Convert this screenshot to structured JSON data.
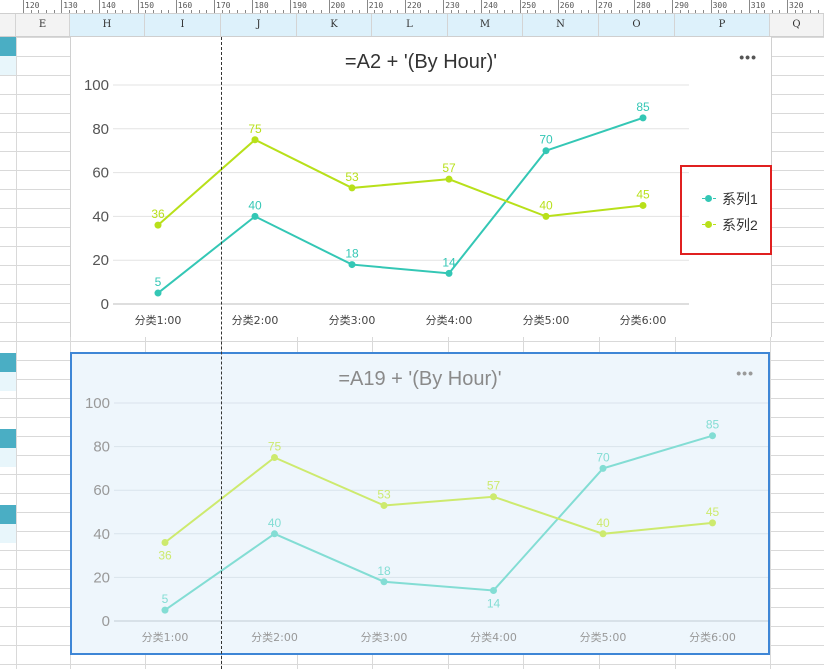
{
  "ruler": {
    "labels": [
      "120",
      "130",
      "140",
      "150",
      "160",
      "170",
      "180",
      "190",
      "200",
      "210",
      "220",
      "230",
      "240",
      "250",
      "260",
      "270",
      "280",
      "290",
      "300",
      "310",
      "320"
    ]
  },
  "columns": [
    "E",
    "H",
    "I",
    "J",
    "K",
    "L",
    "M",
    "N",
    "O",
    "P",
    "Q"
  ],
  "colors": {
    "series1": "#34c7b5",
    "series2": "#b8e01a",
    "selection": "#3e86d6",
    "legend_border": "#e02020"
  },
  "chart1": {
    "title": "=A2 + '(By Hour)'",
    "more_label": "•••",
    "legend": [
      "系列1",
      "系列2"
    ]
  },
  "chart2": {
    "title": "=A19 + '(By Hour)'",
    "more_label": "•••"
  },
  "chart_data": [
    {
      "type": "line",
      "title": "=A2 + '(By Hour)'",
      "categories": [
        "分类1:00",
        "分类2:00",
        "分类3:00",
        "分类4:00",
        "分类5:00",
        "分类6:00"
      ],
      "series": [
        {
          "name": "系列1",
          "values": [
            5,
            40,
            18,
            14,
            70,
            85
          ]
        },
        {
          "name": "系列2",
          "values": [
            36,
            75,
            53,
            57,
            40,
            45
          ]
        }
      ],
      "yticks": [
        0,
        20,
        40,
        60,
        80,
        100
      ],
      "ylim": [
        0,
        100
      ],
      "grid": true,
      "legend": "right"
    },
    {
      "type": "line",
      "title": "=A19 + '(By Hour)'",
      "categories": [
        "分类1:00",
        "分类2:00",
        "分类3:00",
        "分类4:00",
        "分类5:00",
        "分类6:00"
      ],
      "series": [
        {
          "values": [
            5,
            40,
            18,
            14,
            70,
            85
          ]
        },
        {
          "values": [
            36,
            75,
            53,
            57,
            40,
            45
          ]
        }
      ],
      "yticks": [
        0,
        20,
        40,
        60,
        80,
        100
      ],
      "ylim": [
        0,
        100
      ],
      "grid": true
    }
  ]
}
